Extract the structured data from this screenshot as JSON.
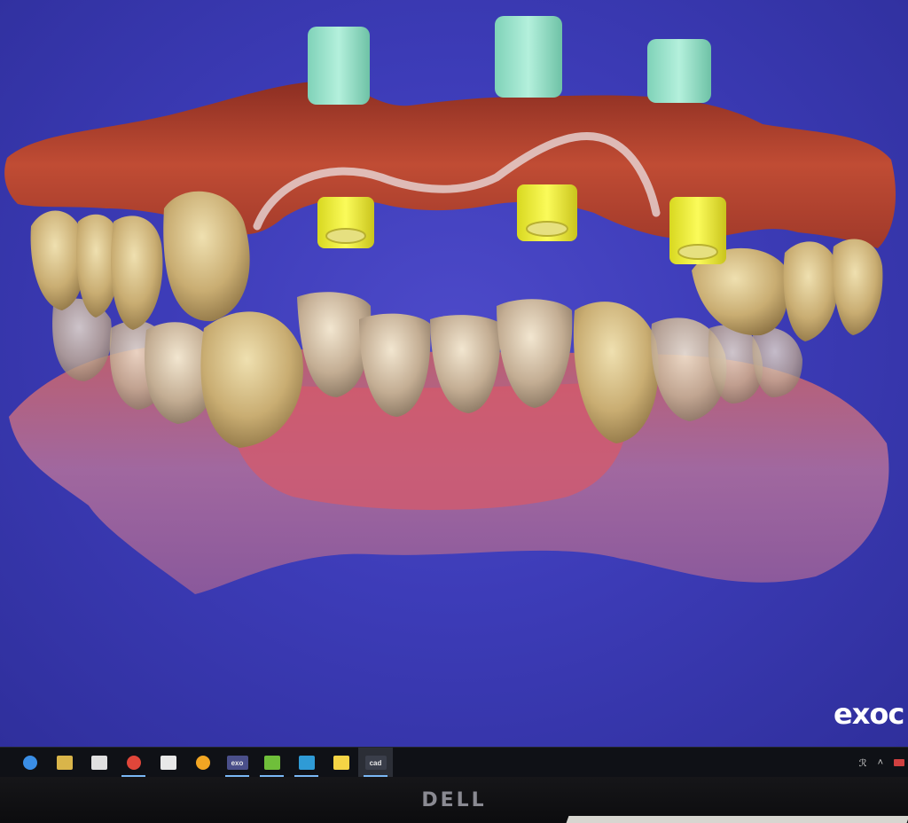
{
  "app": {
    "brand_text": "exoc"
  },
  "taskbar": {
    "items": [
      {
        "name": "edge",
        "icon": "edge-icon",
        "label": "",
        "color": "#3a8ee6",
        "active": false
      },
      {
        "name": "file-explorer",
        "icon": "folder-icon",
        "label": "",
        "color": "#d9b54a",
        "active": false
      },
      {
        "name": "store",
        "icon": "store-icon",
        "label": "",
        "color": "#e0e0e0",
        "active": false
      },
      {
        "name": "chrome",
        "icon": "chrome-icon",
        "label": "",
        "color": "#e0463a",
        "active": true
      },
      {
        "name": "mail",
        "icon": "mail-icon",
        "label": "",
        "color": "#e8e8e8",
        "active": false
      },
      {
        "name": "app-orange",
        "icon": "orange-circle-icon",
        "label": "",
        "color": "#f2a623",
        "active": false
      },
      {
        "name": "exo",
        "icon": "exo-icon",
        "label": "exo",
        "color": "#4a4f8a",
        "active": true
      },
      {
        "name": "app-green",
        "icon": "green-app-icon",
        "label": "",
        "color": "#6fbf3a",
        "active": true
      },
      {
        "name": "app-blue",
        "icon": "blue-app-icon",
        "label": "",
        "color": "#2f9bd6",
        "active": true
      },
      {
        "name": "sticky-notes",
        "icon": "note-icon",
        "label": "",
        "color": "#f5d445",
        "active": false
      },
      {
        "name": "cad",
        "icon": "cad-icon",
        "label": "cad",
        "color": "#3a3e4a",
        "active": true,
        "current": true
      }
    ],
    "tray": {
      "people_glyph": "ℛ",
      "chevron_glyph": "˄"
    }
  },
  "monitor": {
    "bezel_logo": "DELL"
  },
  "colors": {
    "background": "#3d3cb8",
    "gingiva_upper": "#b5452e",
    "gingiva_lower": "#a8669e",
    "tooth": "#c9ad72",
    "scan_body": "#8fe0c6",
    "analog": "#f0ef2a"
  }
}
